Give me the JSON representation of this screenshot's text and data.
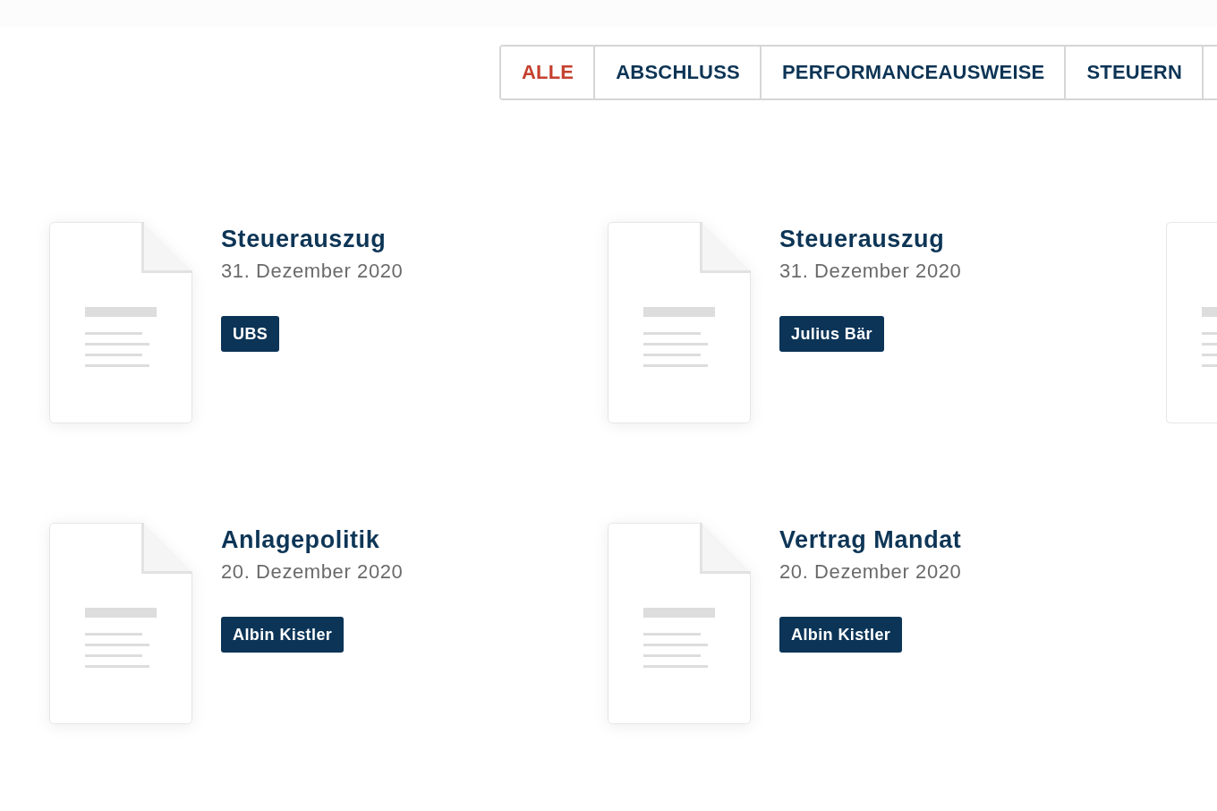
{
  "tabs": [
    {
      "label": "ALLE",
      "selected": true
    },
    {
      "label": "ABSCHLUSS",
      "selected": false
    },
    {
      "label": "PERFORMANCEAUSWEISE",
      "selected": false
    },
    {
      "label": "STEUERN",
      "selected": false
    }
  ],
  "documents": [
    {
      "kind": "full",
      "title": "Steuerauszug",
      "date": "31. Dezember 2020",
      "tag": "UBS"
    },
    {
      "kind": "full",
      "title": "Steuerauszug",
      "date": "31. Dezember 2020",
      "tag": "Julius Bär"
    },
    {
      "kind": "icon_only"
    },
    {
      "kind": "full",
      "title": "Anlagepolitik",
      "date": "20. Dezember 2020",
      "tag": "Albin Kistler"
    },
    {
      "kind": "full",
      "title": "Vertrag Mandat",
      "date": "20. Dezember 2020",
      "tag": "Albin Kistler"
    }
  ]
}
